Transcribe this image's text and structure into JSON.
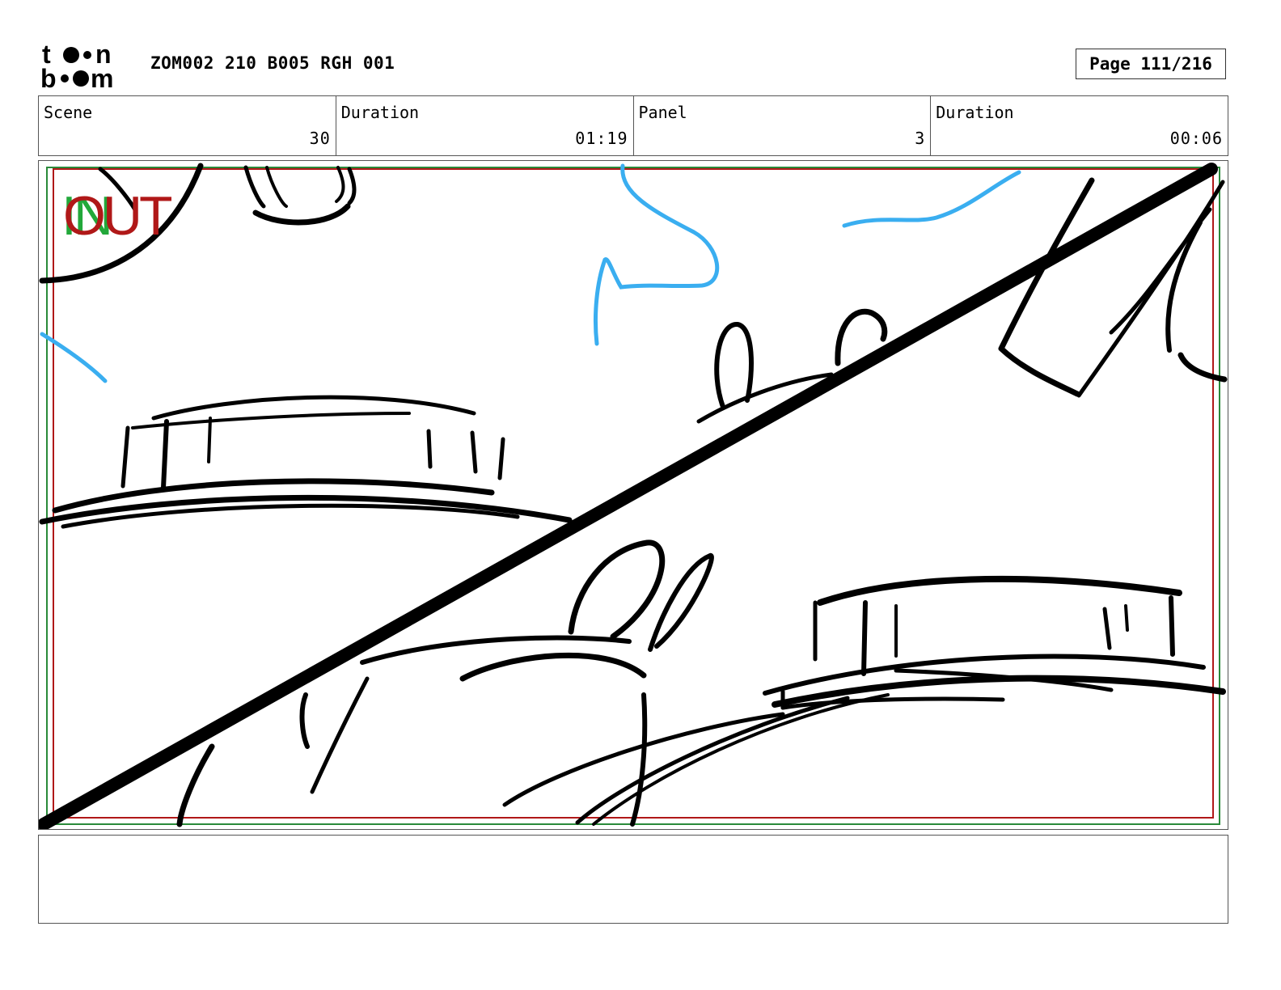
{
  "header": {
    "logo_text": "toon boom",
    "project_title": "ZOM002 210 B005 RGH 001",
    "page_label": "Page 111/216"
  },
  "info": {
    "scene_label": "Scene",
    "scene_value": "30",
    "scene_duration_label": "Duration",
    "scene_duration_value": "01:19",
    "panel_label": "Panel",
    "panel_value": "3",
    "panel_duration_label": "Duration",
    "panel_duration_value": "00:06"
  },
  "panel": {
    "in_marker": "IN",
    "out_marker": "OUT",
    "colors": {
      "sketch": "#000000",
      "accent_sketch": "#3aaef0",
      "in_marker": "#22a83a",
      "out_marker": "#b01818",
      "safe_frame_red": "#b01818",
      "safe_frame_green": "#2a8a3a"
    }
  },
  "notes": {
    "text": ""
  }
}
